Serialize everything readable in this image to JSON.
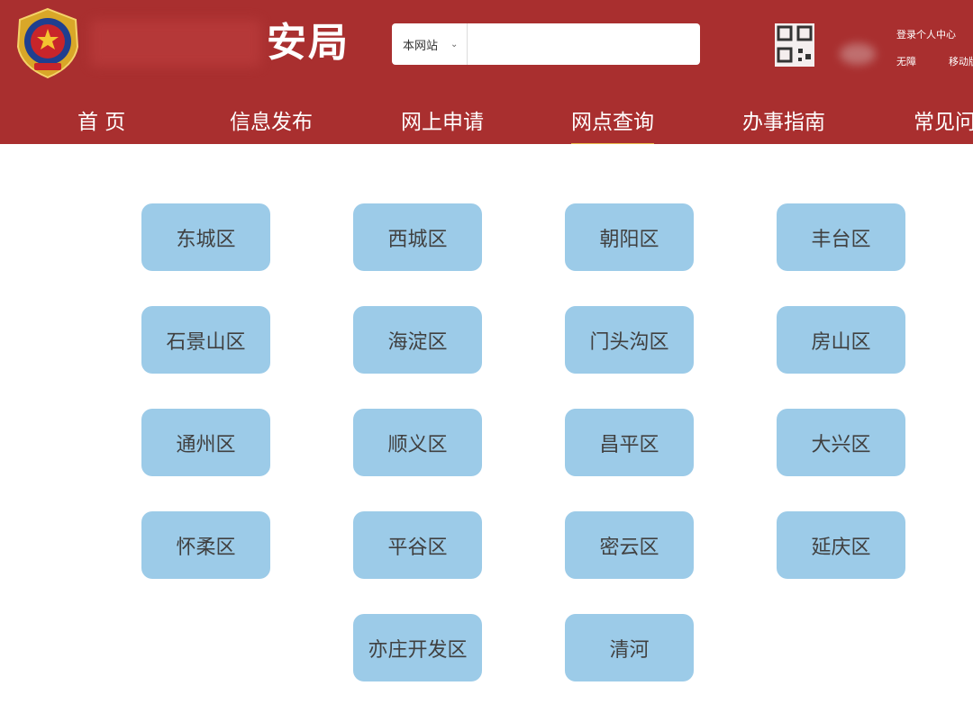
{
  "header": {
    "title_visible": "安局",
    "search": {
      "scope": "本网站",
      "placeholder": "",
      "value": ""
    },
    "top_links": {
      "login": "登录个人中心",
      "accessibility": "无障",
      "mobile": "移动版"
    }
  },
  "nav": {
    "items": [
      {
        "label": "首 页"
      },
      {
        "label": "信息发布"
      },
      {
        "label": "网上申请"
      },
      {
        "label": "网点查询",
        "active": true
      },
      {
        "label": "办事指南"
      },
      {
        "label": "常见问"
      }
    ]
  },
  "districts": [
    "东城区",
    "西城区",
    "朝阳区",
    "丰台区",
    "石景山区",
    "海淀区",
    "门头沟区",
    "房山区",
    "通州区",
    "顺义区",
    "昌平区",
    "大兴区",
    "怀柔区",
    "平谷区",
    "密云区",
    "延庆区",
    "亦庄开发区",
    "清河"
  ],
  "colors": {
    "header_bg": "#a92f2f",
    "nav_active_underline": "#e8b84a",
    "district_bg": "#9ccbe8",
    "district_text": "#404040"
  },
  "icons": {
    "emblem": "police-emblem-icon",
    "qr": "qr-code-icon",
    "dropdown": "chevron-down-icon"
  }
}
